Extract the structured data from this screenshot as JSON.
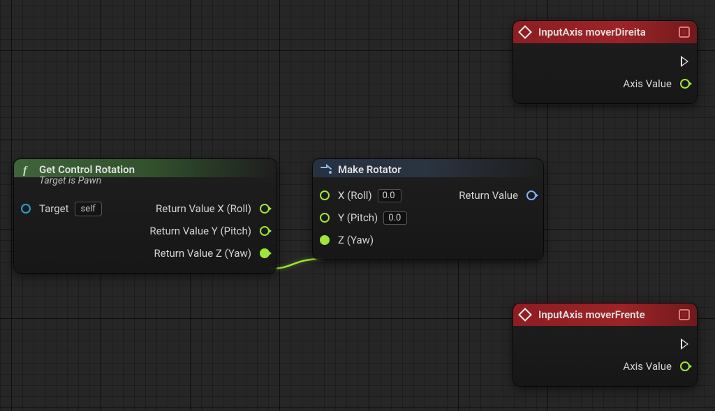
{
  "nodes": {
    "getControlRotation": {
      "title": "Get Control Rotation",
      "subtitle": "Target is Pawn",
      "target_label": "Target",
      "target_default": "self",
      "out_x": "Return Value X (Roll)",
      "out_y": "Return Value Y (Pitch)",
      "out_z": "Return Value Z (Yaw)"
    },
    "makeRotator": {
      "title": "Make Rotator",
      "in_x": "X (Roll)",
      "in_y": "Y (Pitch)",
      "in_z": "Z (Yaw)",
      "val_x": "0.0",
      "val_y": "0.0",
      "out": "Return Value"
    },
    "inputAxisDireita": {
      "title": "InputAxis moverDireita",
      "axis_label": "Axis Value"
    },
    "inputAxisFrente": {
      "title": "InputAxis moverFrente",
      "axis_label": "Axis Value"
    }
  },
  "icons": {
    "fn": "function-italic-f-icon",
    "pure": "convert-icon",
    "event": "event-diamond-icon"
  },
  "colors": {
    "float": "#9ee639",
    "rotator": "#7db3ff",
    "object": "#2aa3cb",
    "event_red": "#8e1d21",
    "fn_green": "#3f633a"
  }
}
